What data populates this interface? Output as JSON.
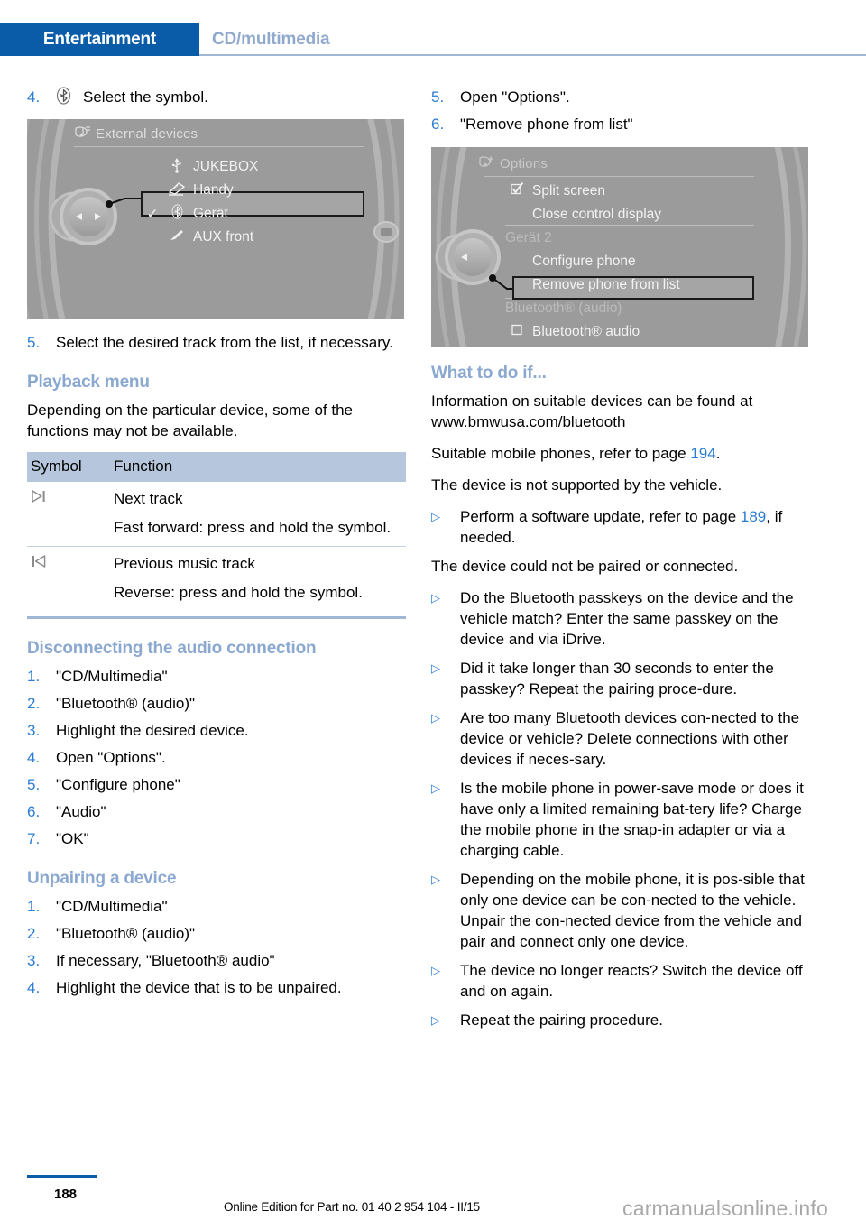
{
  "header": {
    "active_tab": "Entertainment",
    "inactive_tab": "CD/multimedia",
    "accent_color": "#0b5ca8",
    "inactive_color": "#8fa9cd"
  },
  "left_column": {
    "step4": {
      "num": "4.",
      "icon": "bluetooth-circle-icon",
      "text": "Select the symbol."
    },
    "idrive_external_devices": {
      "title": "External devices",
      "title_icon": "multimedia-note-icon",
      "items": [
        {
          "check": "",
          "icon": "usb-icon",
          "label": "JUKEBOX",
          "highlighted": false
        },
        {
          "check": "",
          "icon": "phone-icon",
          "label": "Handy",
          "highlighted": false
        },
        {
          "check": "✓",
          "icon": "bluetooth-icon",
          "label": "Gerät",
          "highlighted": true
        },
        {
          "check": "",
          "icon": "aux-plug-icon",
          "label": "AUX front",
          "highlighted": false
        }
      ]
    },
    "step5": {
      "num": "5.",
      "text": "Select the desired track from the list, if necessary."
    },
    "playback_menu": {
      "heading": "Playback menu",
      "intro": "Depending on the particular device, some of the functions may not be available.",
      "table": {
        "headers": [
          "Symbol",
          "Function"
        ],
        "rows": [
          {
            "symbol_icon": "next-track-icon",
            "lines": [
              "Next track",
              "Fast forward: press and hold the symbol."
            ]
          },
          {
            "symbol_icon": "previous-track-icon",
            "lines": [
              "Previous music track",
              "Reverse: press and hold the symbol."
            ]
          }
        ]
      }
    },
    "disconnecting": {
      "heading": "Disconnecting the audio connection",
      "steps": [
        {
          "num": "1.",
          "text": "\"CD/Multimedia\""
        },
        {
          "num": "2.",
          "text": "\"Bluetooth® (audio)\""
        },
        {
          "num": "3.",
          "text": "Highlight the desired device."
        },
        {
          "num": "4.",
          "text": "Open \"Options\"."
        },
        {
          "num": "5.",
          "text": "\"Configure phone\""
        },
        {
          "num": "6.",
          "text": "\"Audio\""
        },
        {
          "num": "7.",
          "text": "\"OK\""
        }
      ]
    },
    "unpairing": {
      "heading": "Unpairing a device",
      "steps": [
        {
          "num": "1.",
          "text": "\"CD/Multimedia\""
        },
        {
          "num": "2.",
          "text": "\"Bluetooth® (audio)\""
        },
        {
          "num": "3.",
          "text": "If necessary, \"Bluetooth® audio\""
        },
        {
          "num": "4.",
          "text": "Highlight the device that is to be unpaired."
        }
      ]
    }
  },
  "right_column": {
    "steps_top": [
      {
        "num": "5.",
        "text": "Open \"Options\"."
      },
      {
        "num": "6.",
        "text": "\"Remove phone from list\""
      }
    ],
    "idrive_options": {
      "title": "Options",
      "title_icon": "multimedia-note-icon",
      "items": [
        {
          "check": "checked-box",
          "label": "Split screen",
          "dim": false,
          "highlighted": false,
          "indent": 0
        },
        {
          "check": "",
          "label": "Close control display",
          "dim": false,
          "highlighted": false,
          "indent": 0
        },
        {
          "check": "",
          "label": "Gerät 2",
          "dim": true,
          "highlighted": false,
          "indent": -1
        },
        {
          "check": "",
          "label": "Configure phone",
          "dim": false,
          "highlighted": false,
          "indent": 0
        },
        {
          "check": "",
          "label": "Remove phone from list",
          "dim": false,
          "highlighted": true,
          "indent": 0
        },
        {
          "check": "",
          "label": "Bluetooth® (audio)",
          "dim": true,
          "highlighted": false,
          "indent": -1
        },
        {
          "check": "empty-box",
          "label": "Bluetooth® audio",
          "dim": false,
          "highlighted": false,
          "indent": 0
        }
      ]
    },
    "what_to_do": {
      "heading": "What to do if...",
      "para1": "Information on suitable devices can be found at www.bmwusa.com/bluetooth",
      "para2_pre": "Suitable mobile phones, refer to page ",
      "para2_link": "194",
      "para2_post": ".",
      "para3": "The device is not supported by the vehicle.",
      "bullet1_pre": "Perform a software update, refer to page ",
      "bullet1_link": "189",
      "bullet1_post": ", if needed.",
      "para4": "The device could not be paired or connected.",
      "bullets": [
        "Do the Bluetooth passkeys on the device and the vehicle match? Enter the same passkey on the device and via iDrive.",
        "Did it take longer than 30 seconds to enter the passkey? Repeat the pairing proce-dure.",
        "Are too many Bluetooth devices con-nected to the device or vehicle? Delete connections with other devices if neces-sary.",
        "Is the mobile phone in power-save mode or does it have only a limited remaining bat-tery life? Charge the mobile phone in the snap-in adapter or via a charging cable.",
        "Depending on the mobile phone, it is pos-sible that only one device can be con-nected to the vehicle. Unpair the con-nected device from the vehicle and pair and connect only one device.",
        "The device no longer reacts? Switch the device off and on again.",
        "Repeat the pairing procedure."
      ]
    }
  },
  "footer": {
    "page_number": "188",
    "edition": "Online Edition for Part no. 01 40 2 954 104 - II/15",
    "watermark": "carmanualsonline.info"
  }
}
